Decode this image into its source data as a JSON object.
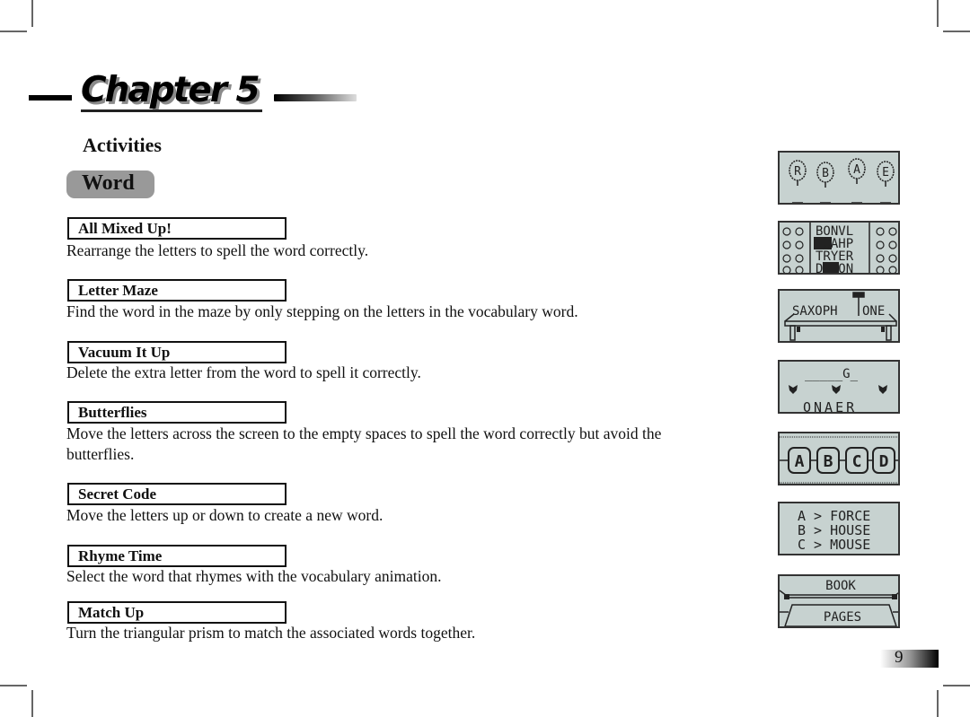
{
  "chapter": {
    "title": "Chapter 5"
  },
  "section": {
    "title": "Activities"
  },
  "category": {
    "label": "Word"
  },
  "activities": [
    {
      "name": "All Mixed Up!",
      "description": "Rearrange the letters to spell the word correctly."
    },
    {
      "name": "Letter Maze",
      "description": "Find the word in the maze by only stepping on the letters in the vocabulary word."
    },
    {
      "name": "Vacuum It Up",
      "description": "Delete the extra letter from the word to spell it correctly."
    },
    {
      "name": "Butterflies",
      "description": "Move the letters across the screen to the empty spaces to spell the word correctly but avoid the butterflies."
    },
    {
      "name": "Secret Code",
      "description": "Move the letters up or down to create a new word."
    },
    {
      "name": "Rhyme Time",
      "description": "Select the word that rhymes with the vocabulary animation."
    },
    {
      "name": "Match Up",
      "description": "Turn the triangular prism to match the associated words together."
    }
  ],
  "screens": {
    "all_mixed_up": {
      "balloons": [
        "R",
        "B",
        "A",
        "E"
      ]
    },
    "letter_maze": {
      "rows": [
        "BONVL",
        "HOAHP",
        "TRYER",
        "DSEON"
      ]
    },
    "vacuum": {
      "left": "SAXOPH",
      "right": "ONE"
    },
    "butterflies": {
      "target": "_____G_",
      "letters": "ONAER"
    },
    "secret_code": {
      "letters": [
        "A",
        "B",
        "C",
        "D"
      ]
    },
    "rhyme_time": {
      "options": [
        "A > FORCE",
        "B > HOUSE",
        "C > MOUSE"
      ]
    },
    "match_up": {
      "top": "BOOK",
      "bottom": "PAGES"
    }
  },
  "page": {
    "number": "9"
  },
  "colors": {
    "lcd_bg": "#c7d2d0",
    "pill_bg": "#999999"
  }
}
